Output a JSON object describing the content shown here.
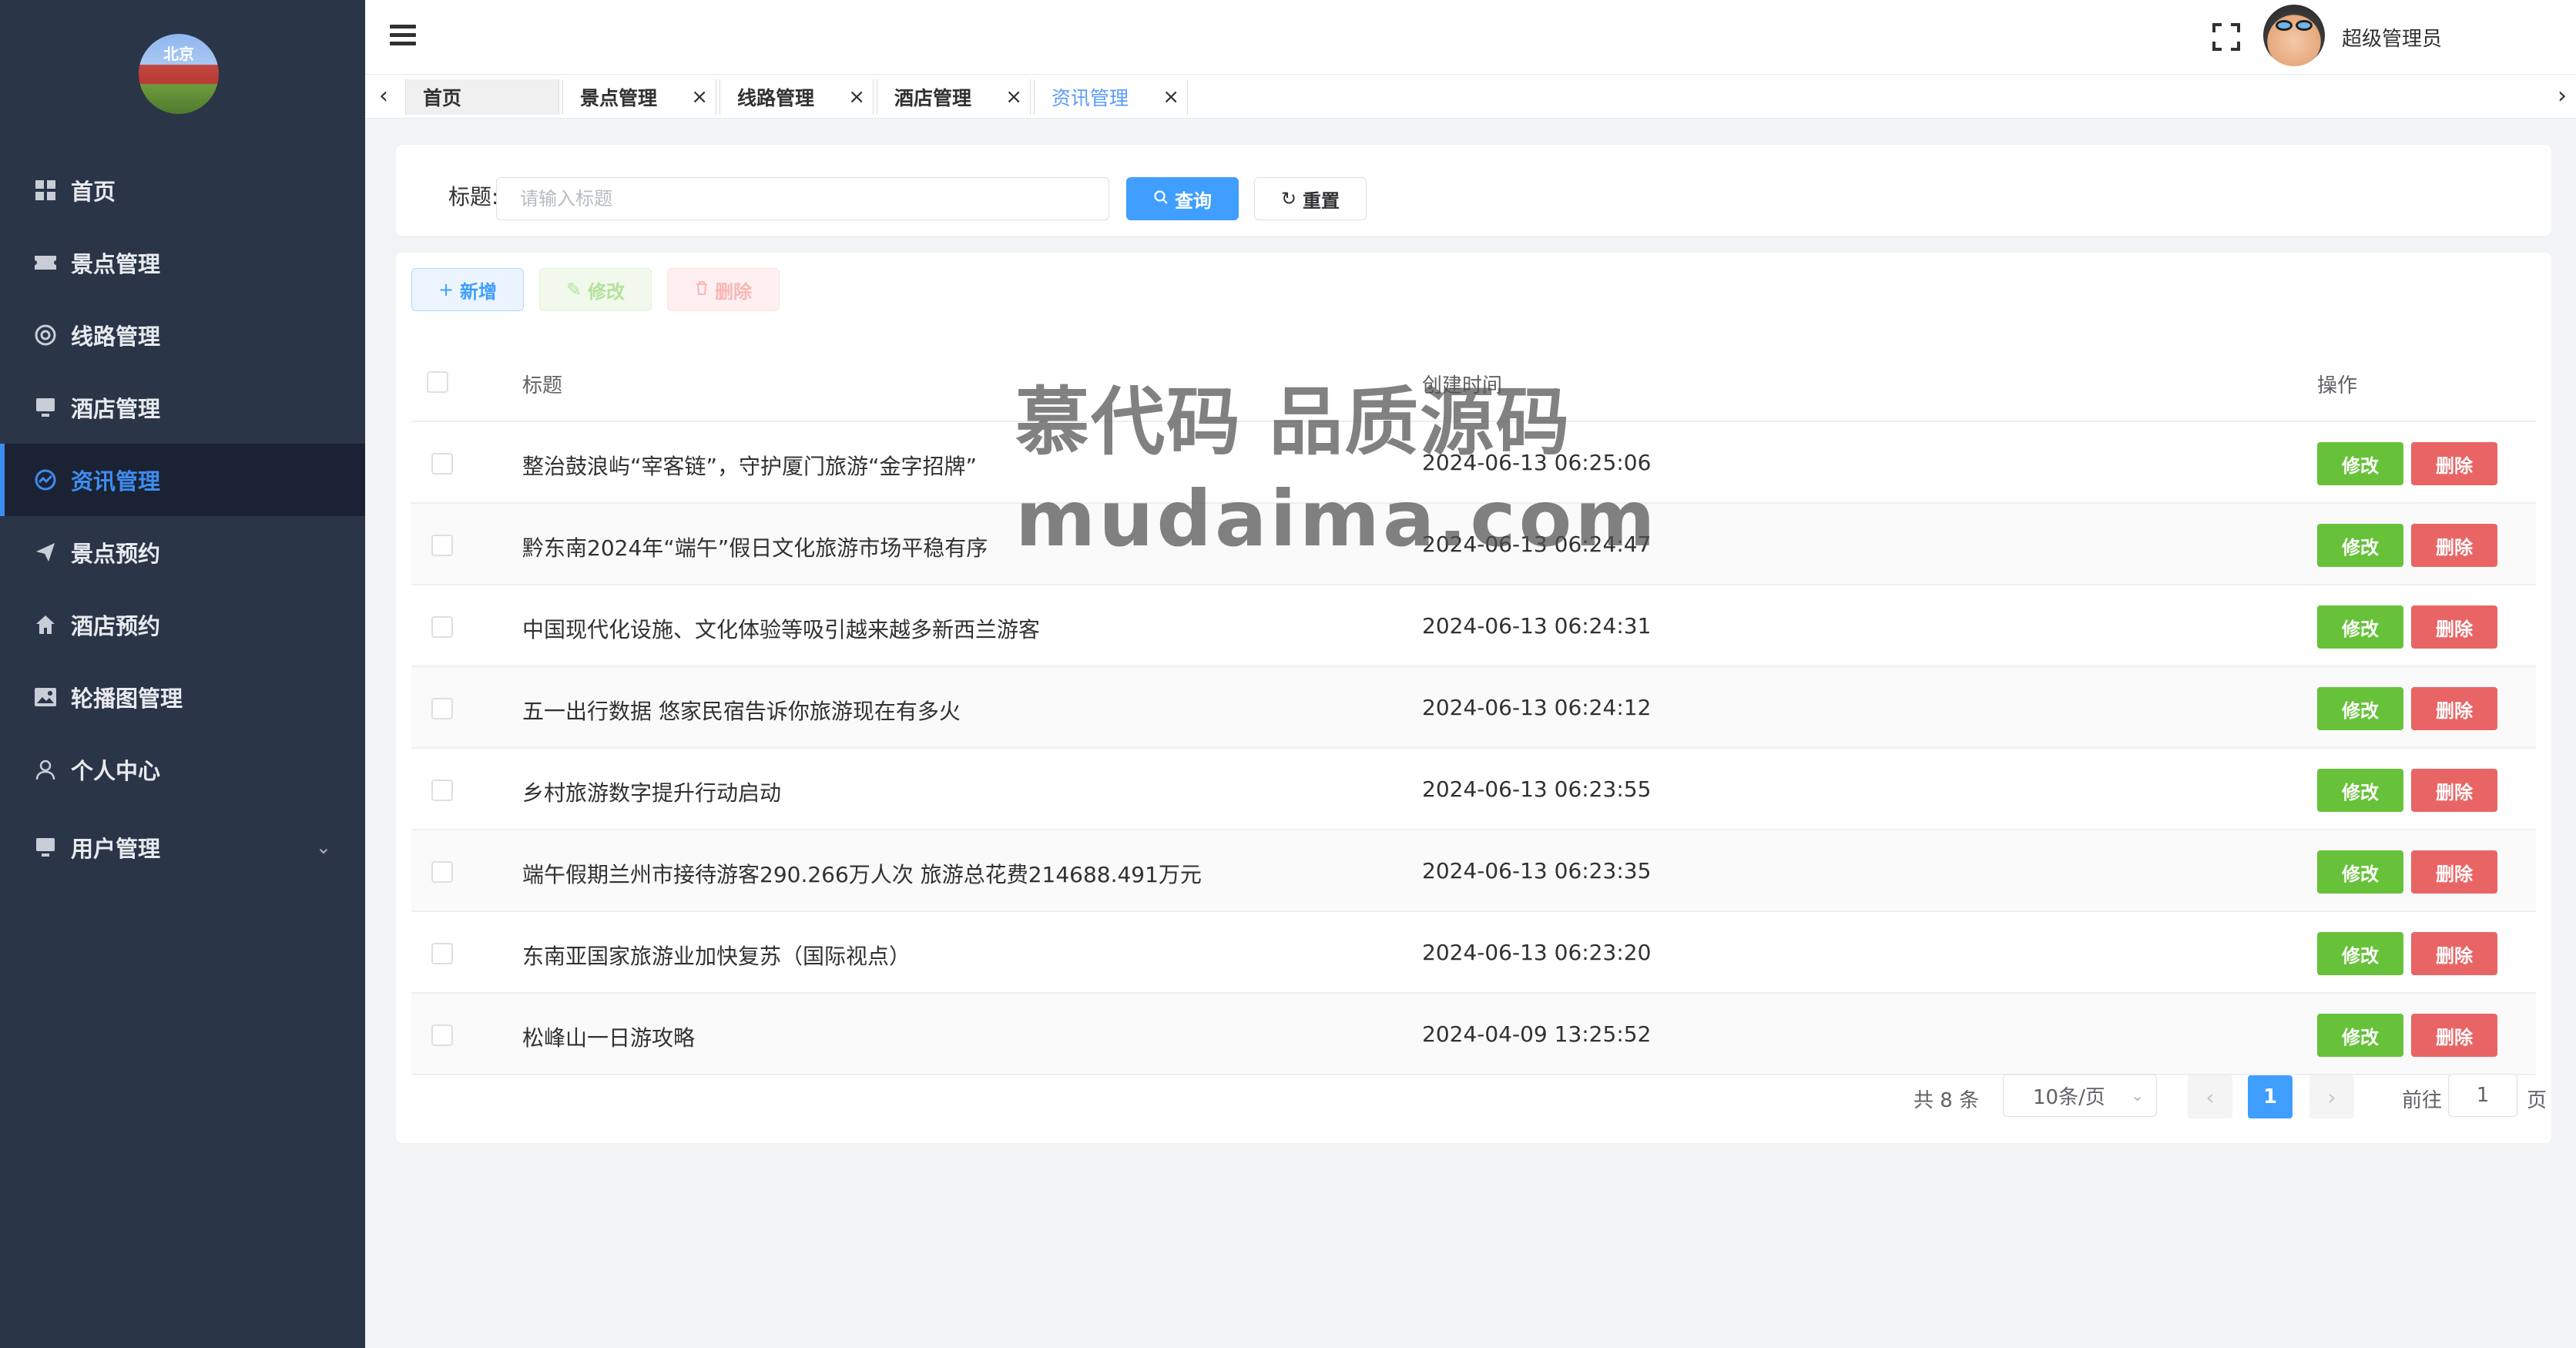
{
  "logo": {
    "text": "北京"
  },
  "sidebar": {
    "items": [
      {
        "label": "首页",
        "icon": "grid-icon"
      },
      {
        "label": "景点管理",
        "icon": "ticket-icon"
      },
      {
        "label": "线路管理",
        "icon": "lifebuoy-icon"
      },
      {
        "label": "酒店管理",
        "icon": "monitor-icon"
      },
      {
        "label": "资讯管理",
        "icon": "chart-icon",
        "active": true
      },
      {
        "label": "景点预约",
        "icon": "send-icon"
      },
      {
        "label": "酒店预约",
        "icon": "home-icon"
      },
      {
        "label": "轮播图管理",
        "icon": "picture-icon"
      },
      {
        "label": "个人中心",
        "icon": "user-icon"
      },
      {
        "label": "用户管理",
        "icon": "monitor-icon"
      }
    ]
  },
  "header": {
    "username": "超级管理员"
  },
  "tabs": [
    {
      "label": "首页"
    },
    {
      "label": "景点管理"
    },
    {
      "label": "线路管理"
    },
    {
      "label": "酒店管理"
    },
    {
      "label": "资讯管理",
      "active": true
    }
  ],
  "search": {
    "label": "标题:",
    "placeholder": "请输入标题",
    "query_label": "查询",
    "reset_label": "重置"
  },
  "toolbar": {
    "add_label": "新增",
    "edit_label": "修改",
    "delete_label": "删除"
  },
  "table": {
    "columns": [
      "标题",
      "创建时间",
      "操作"
    ],
    "edit_label": "修改",
    "delete_label": "删除",
    "rows": [
      {
        "title": "整治鼓浪屿“宰客链”，守护厦门旅游“金字招牌”",
        "created": "2024-06-13 06:25:06"
      },
      {
        "title": "黔东南2024年“端午”假日文化旅游市场平稳有序",
        "created": "2024-06-13 06:24:47"
      },
      {
        "title": "中国现代化设施、文化体验等吸引越来越多新西兰游客",
        "created": "2024-06-13 06:24:31"
      },
      {
        "title": "五一出行数据 悠家民宿告诉你旅游现在有多火",
        "created": "2024-06-13 06:24:12"
      },
      {
        "title": "乡村旅游数字提升行动启动",
        "created": "2024-06-13 06:23:55"
      },
      {
        "title": "端午假期兰州市接待游客290.266万人次 旅游总花费214688.491万元",
        "created": "2024-06-13 06:23:35"
      },
      {
        "title": "东南亚国家旅游业加快复苏（国际视点）",
        "created": "2024-06-13 06:23:20"
      },
      {
        "title": "松峰山一日游攻略",
        "created": "2024-04-09 13:25:52"
      }
    ]
  },
  "pagination": {
    "total_text": "共 8 条",
    "page_size": "10条/页",
    "current_page": "1",
    "goto_label": "前往",
    "goto_value": "1",
    "page_suffix": "页"
  },
  "watermark": {
    "line1": "慕代码 品质源码",
    "line2": "mudaima.com"
  },
  "colors": {
    "sidebar_bg": "#2b3548",
    "primary": "#409eff",
    "success": "#67c23a",
    "danger": "#e96565"
  }
}
